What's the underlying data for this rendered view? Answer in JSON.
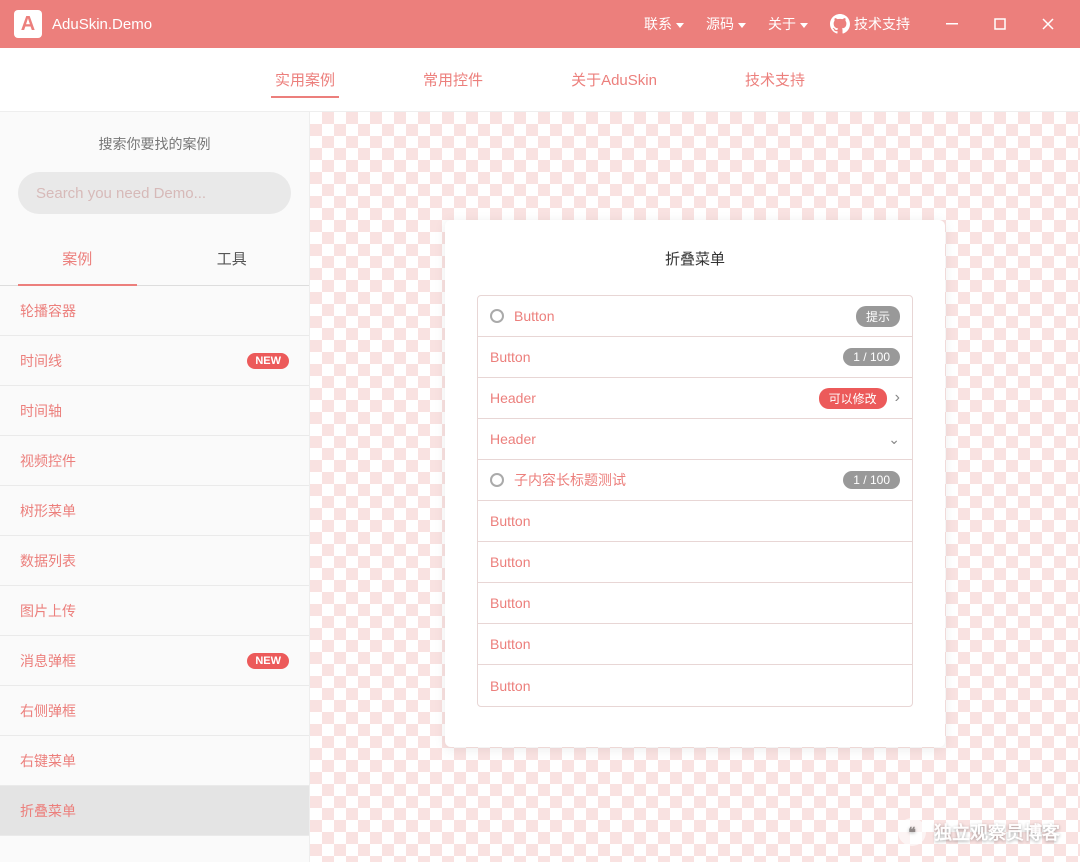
{
  "titlebar": {
    "app_title": "AduSkin.Demo",
    "menu": [
      {
        "label": "联系"
      },
      {
        "label": "源码"
      },
      {
        "label": "关于"
      }
    ],
    "support": "技术支持"
  },
  "tabs": [
    {
      "label": "实用案例",
      "active": true
    },
    {
      "label": "常用控件",
      "active": false
    },
    {
      "label": "关于AduSkin",
      "active": false
    },
    {
      "label": "技术支持",
      "active": false
    }
  ],
  "sidebar": {
    "search_title": "搜索你要找的案例",
    "search_placeholder": "Search you need Demo...",
    "sub_tabs": [
      {
        "label": "案例",
        "active": true
      },
      {
        "label": "工具",
        "active": false
      }
    ],
    "items": [
      {
        "label": "轮播容器",
        "badge": null,
        "selected": false
      },
      {
        "label": "时间线",
        "badge": "NEW",
        "selected": false
      },
      {
        "label": "时间轴",
        "badge": null,
        "selected": false
      },
      {
        "label": "视频控件",
        "badge": null,
        "selected": false
      },
      {
        "label": "树形菜单",
        "badge": null,
        "selected": false
      },
      {
        "label": "数据列表",
        "badge": null,
        "selected": false
      },
      {
        "label": "图片上传",
        "badge": null,
        "selected": false
      },
      {
        "label": "消息弹框",
        "badge": "NEW",
        "selected": false
      },
      {
        "label": "右侧弹框",
        "badge": null,
        "selected": false
      },
      {
        "label": "右键菜单",
        "badge": null,
        "selected": false
      },
      {
        "label": "折叠菜单",
        "badge": null,
        "selected": true
      }
    ]
  },
  "card": {
    "title": "折叠菜单",
    "rows": [
      {
        "circle": true,
        "label": "Button",
        "pill": "提示",
        "pill_color": "gray",
        "arrow": null
      },
      {
        "circle": false,
        "label": "Button",
        "pill": "1 / 100",
        "pill_color": "gray",
        "arrow": null
      },
      {
        "circle": false,
        "label": "Header",
        "pill": "可以修改",
        "pill_color": "red",
        "arrow": "right"
      },
      {
        "circle": false,
        "label": "Header",
        "pill": null,
        "pill_color": null,
        "arrow": "down"
      },
      {
        "circle": true,
        "label": "子内容长标题测试",
        "pill": "1 / 100",
        "pill_color": "gray",
        "arrow": null
      },
      {
        "circle": false,
        "label": "Button",
        "pill": null,
        "pill_color": null,
        "arrow": null
      },
      {
        "circle": false,
        "label": "Button",
        "pill": null,
        "pill_color": null,
        "arrow": null
      },
      {
        "circle": false,
        "label": "Button",
        "pill": null,
        "pill_color": null,
        "arrow": null
      },
      {
        "circle": false,
        "label": "Button",
        "pill": null,
        "pill_color": null,
        "arrow": null
      },
      {
        "circle": false,
        "label": "Button",
        "pill": null,
        "pill_color": null,
        "arrow": null
      }
    ]
  },
  "watermark": "独立观察员博客"
}
